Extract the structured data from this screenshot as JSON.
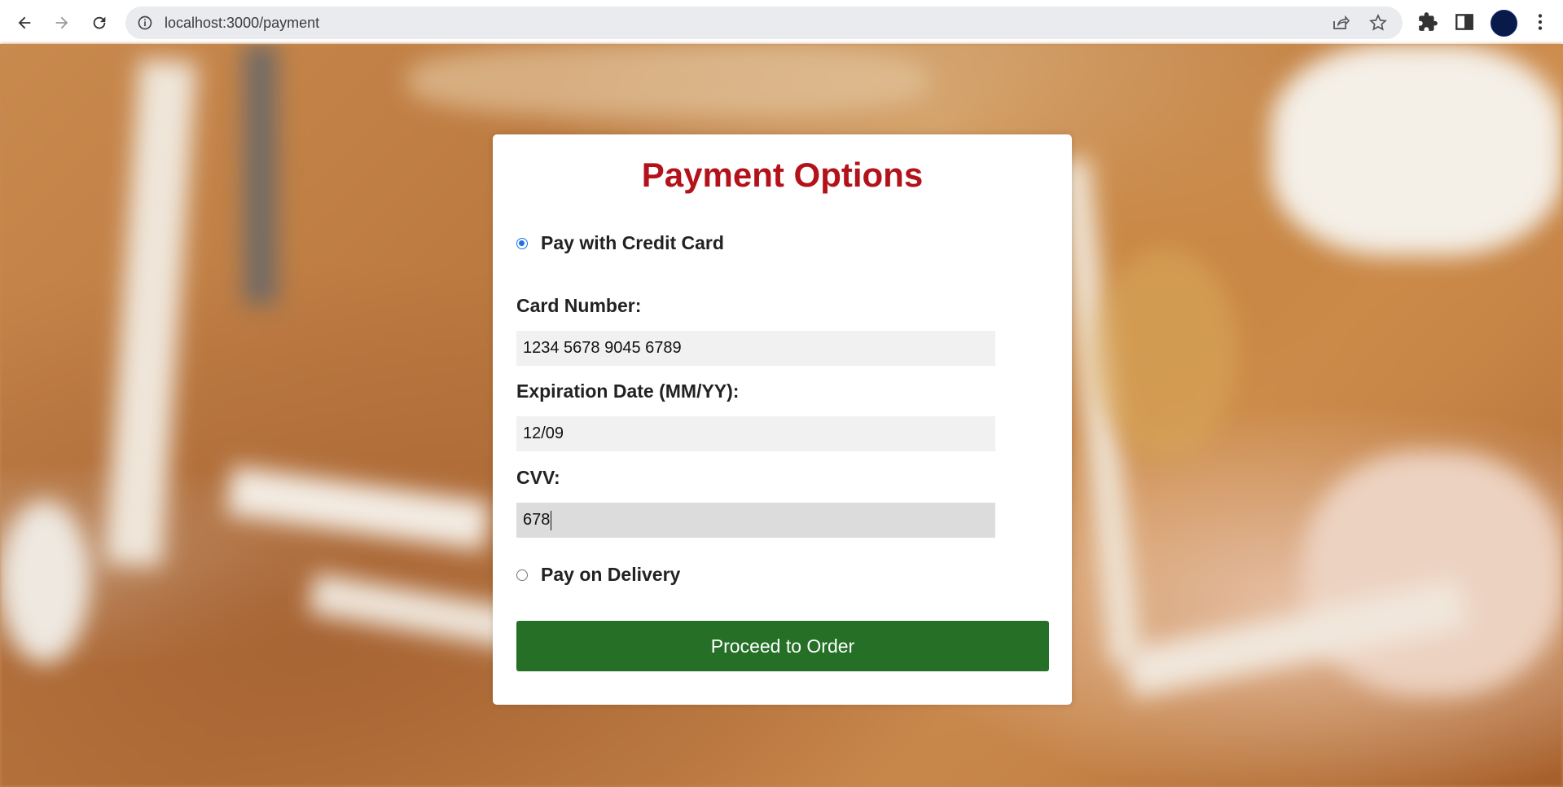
{
  "browser": {
    "url": "localhost:3000/payment"
  },
  "payment": {
    "title": "Payment Options",
    "credit_card_option": {
      "label": "Pay with Credit Card",
      "selected": true
    },
    "fields": {
      "card_number": {
        "label": "Card Number:",
        "value": "1234 5678 9045 6789"
      },
      "expiration": {
        "label": "Expiration Date (MM/YY):",
        "value": "12/09"
      },
      "cvv": {
        "label": "CVV:",
        "value": "678"
      }
    },
    "delivery_option": {
      "label": "Pay on Delivery",
      "selected": false
    },
    "proceed_button": {
      "label": "Proceed to Order"
    }
  },
  "colors": {
    "title": "#b3121a",
    "button": "#256f27",
    "radio_accent": "#1a73e8"
  },
  "icons": [
    "back-icon",
    "forward-icon",
    "reload-icon",
    "info-icon",
    "share-icon",
    "star-icon",
    "extensions-icon",
    "side-panel-icon",
    "menu-icon"
  ]
}
